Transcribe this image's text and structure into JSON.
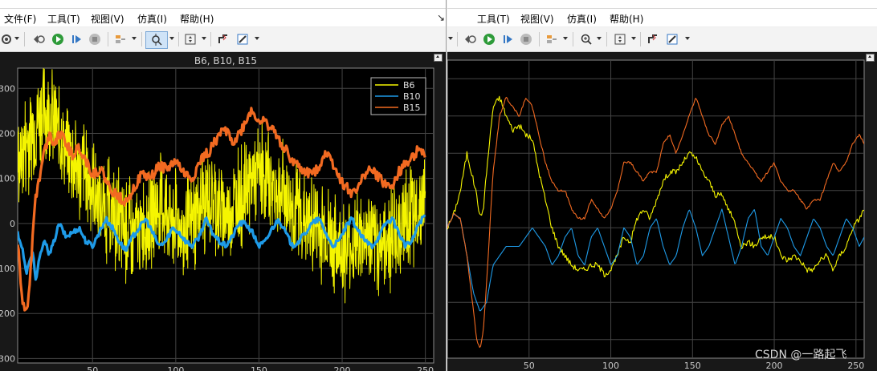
{
  "left_window": {
    "menu": [
      "文件(F)",
      "工具(T)",
      "视图(V)",
      "仿真(I)",
      "帮助(H)"
    ],
    "plot_title": "B6, B10, B15"
  },
  "right_window": {
    "menu": [
      "工具(T)",
      "视图(V)",
      "仿真(I)",
      "帮助(H)"
    ]
  },
  "watermark": "CSDN @一路起飞",
  "colors": {
    "B6": "#f5f500",
    "B10": "#1e9be8",
    "B15": "#f26a21"
  },
  "chart_data": [
    {
      "type": "line",
      "title": "B6, B10, B15",
      "xlabel": "",
      "ylabel": "",
      "xlim": [
        5,
        255
      ],
      "ylim": [
        -310,
        345
      ],
      "xticks": [
        50,
        100,
        150,
        200,
        250
      ],
      "ytick_labels": [
        "300",
        "200",
        "100",
        "0",
        "100",
        "200",
        "300"
      ],
      "ytick_values": [
        300,
        200,
        100,
        0,
        -100,
        -200,
        -300
      ],
      "grid": true,
      "legend": {
        "placement": "top-right",
        "entries": [
          "B6",
          "B10",
          "B15"
        ]
      },
      "series": [
        {
          "name": "B6",
          "style": "noisy",
          "x": [
            5,
            10,
            15,
            20,
            25,
            30,
            35,
            40,
            45,
            50,
            55,
            60,
            65,
            70,
            75,
            80,
            85,
            90,
            95,
            100,
            105,
            110,
            115,
            120,
            125,
            130,
            135,
            140,
            145,
            150,
            155,
            160,
            165,
            170,
            175,
            180,
            185,
            190,
            195,
            200,
            205,
            210,
            215,
            220,
            225,
            230,
            235,
            240,
            245,
            250
          ],
          "values": [
            130,
            180,
            220,
            250,
            240,
            200,
            160,
            130,
            110,
            80,
            40,
            20,
            0,
            -20,
            -30,
            -10,
            20,
            40,
            30,
            0,
            -20,
            0,
            40,
            60,
            40,
            20,
            40,
            70,
            90,
            110,
            100,
            80,
            60,
            40,
            20,
            0,
            -10,
            -20,
            -40,
            -60,
            -50,
            -40,
            -30,
            -50,
            -40,
            -30,
            -10,
            10,
            30,
            50
          ],
          "noise": 110
        },
        {
          "name": "B10",
          "x": [
            5,
            8,
            10,
            12,
            14,
            16,
            18,
            20,
            22,
            24,
            26,
            30,
            34,
            38,
            42,
            46,
            50,
            54,
            58,
            62,
            66,
            70,
            74,
            78,
            82,
            86,
            90,
            94,
            98,
            102,
            106,
            110,
            114,
            118,
            122,
            126,
            130,
            134,
            138,
            142,
            146,
            150,
            154,
            158,
            162,
            166,
            170,
            174,
            178,
            182,
            186,
            190,
            194,
            198,
            202,
            206,
            210,
            214,
            218,
            222,
            226,
            230,
            234,
            238,
            242,
            246,
            250
          ],
          "values": [
            -20,
            -60,
            -110,
            -90,
            -60,
            -130,
            -80,
            -50,
            -40,
            -70,
            -50,
            0,
            -30,
            -20,
            -10,
            -40,
            -50,
            -20,
            10,
            -10,
            -40,
            -60,
            -30,
            -10,
            10,
            -20,
            -50,
            -40,
            -10,
            -20,
            -40,
            -50,
            -30,
            10,
            -20,
            -40,
            -50,
            -30,
            0,
            0,
            -20,
            -50,
            -40,
            -10,
            10,
            -20,
            -50,
            -40,
            -20,
            0,
            10,
            -20,
            -50,
            -40,
            -10,
            10,
            -20,
            -40,
            -50,
            -30,
            0,
            10,
            -20,
            -50,
            -40,
            0,
            20
          ],
          "noise": 6,
          "clip_start": 5
        },
        {
          "name": "B15",
          "x": [
            5,
            7,
            9,
            11,
            13,
            15,
            18,
            21,
            24,
            27,
            30,
            34,
            38,
            42,
            46,
            50,
            55,
            60,
            65,
            70,
            75,
            80,
            85,
            90,
            95,
            100,
            105,
            110,
            115,
            120,
            125,
            130,
            135,
            140,
            145,
            150,
            155,
            160,
            165,
            170,
            175,
            180,
            185,
            190,
            195,
            200,
            205,
            210,
            215,
            220,
            225,
            230,
            235,
            240,
            245,
            250
          ],
          "values": [
            -40,
            -140,
            -200,
            -180,
            -90,
            40,
            100,
            160,
            200,
            180,
            200,
            180,
            150,
            170,
            140,
            110,
            120,
            80,
            60,
            50,
            80,
            110,
            100,
            130,
            120,
            140,
            110,
            100,
            140,
            160,
            190,
            210,
            180,
            210,
            250,
            230,
            220,
            200,
            170,
            140,
            120,
            110,
            120,
            160,
            130,
            90,
            70,
            80,
            120,
            110,
            90,
            80,
            120,
            140,
            160,
            150
          ],
          "noise": 12
        }
      ]
    },
    {
      "type": "line",
      "title": "",
      "xlabel": "",
      "ylabel": "",
      "xlim": [
        0,
        255
      ],
      "ylim": [
        -14,
        18
      ],
      "xticks": [
        50,
        100,
        150,
        200,
        250
      ],
      "xtick_labels": [
        "50",
        "100",
        "150",
        "200",
        "250"
      ],
      "grid": true,
      "series": [
        {
          "color": "#f5f500",
          "x": [
            0,
            4,
            8,
            12,
            16,
            18,
            20,
            22,
            24,
            28,
            32,
            36,
            40,
            44,
            48,
            52,
            56,
            60,
            64,
            68,
            72,
            76,
            80,
            84,
            88,
            92,
            96,
            100,
            104,
            108,
            112,
            116,
            120,
            124,
            128,
            132,
            136,
            140,
            144,
            148,
            152,
            156,
            160,
            164,
            168,
            172,
            176,
            180,
            184,
            188,
            192,
            196,
            200,
            204,
            208,
            212,
            216,
            220,
            224,
            228,
            232,
            236,
            240,
            244,
            248,
            252,
            255
          ],
          "values": [
            0,
            1.5,
            4,
            8,
            5,
            3.5,
            1,
            2,
            6,
            13,
            14,
            12,
            10.5,
            11,
            10,
            9.5,
            6,
            3,
            0,
            -2,
            -3,
            -4,
            -4.5,
            -4.5,
            -4,
            -4,
            -5,
            -4.5,
            -3,
            -1,
            -1.5,
            1,
            2,
            1,
            3,
            5,
            6,
            6,
            7,
            8,
            7.5,
            6,
            5,
            3.5,
            3.5,
            2,
            0.5,
            -2,
            -1.5,
            -2,
            -1,
            -1,
            -1,
            -3,
            -3.5,
            -3,
            -3.5,
            -4.5,
            -4.5,
            -3.5,
            -3,
            -4.5,
            -3,
            -2,
            0,
            1,
            2
          ],
          "noise": 0.3
        },
        {
          "color": "#1e9be8",
          "x": [
            0,
            4,
            8,
            12,
            16,
            20,
            24,
            28,
            32,
            36,
            40,
            44,
            48,
            52,
            56,
            60,
            64,
            68,
            72,
            76,
            80,
            84,
            88,
            92,
            96,
            100,
            104,
            108,
            112,
            116,
            120,
            124,
            128,
            132,
            136,
            140,
            144,
            148,
            152,
            156,
            160,
            164,
            168,
            172,
            176,
            180,
            184,
            188,
            192,
            196,
            200,
            204,
            208,
            212,
            216,
            220,
            224,
            228,
            232,
            236,
            240,
            244,
            248,
            252,
            255
          ],
          "values": [
            0,
            1.5,
            1,
            -3,
            -7,
            -9,
            -8,
            -4,
            -3,
            -2,
            -2,
            -2,
            -1,
            0,
            -1,
            -2,
            -4,
            -3,
            -1,
            0,
            -3,
            -4,
            -1,
            0,
            -2,
            -4,
            -3,
            0,
            -1,
            -4,
            -3,
            0,
            1,
            -2,
            -4,
            -3,
            0,
            2,
            0,
            -3,
            -2,
            0,
            2,
            -1,
            -4,
            -2,
            1,
            2,
            -2,
            -3,
            -1,
            1,
            0,
            -2,
            -3,
            -1,
            1,
            0,
            -2,
            -3,
            -1,
            1,
            0,
            -2,
            -1
          ],
          "noise": 0
        },
        {
          "color": "#f26a21",
          "x": [
            0,
            4,
            8,
            12,
            16,
            18,
            20,
            22,
            24,
            26,
            28,
            32,
            36,
            40,
            44,
            48,
            52,
            56,
            60,
            64,
            68,
            72,
            76,
            80,
            84,
            88,
            92,
            96,
            100,
            104,
            108,
            112,
            116,
            120,
            124,
            128,
            132,
            136,
            140,
            144,
            148,
            152,
            156,
            160,
            164,
            168,
            172,
            176,
            180,
            184,
            188,
            192,
            196,
            200,
            204,
            208,
            212,
            216,
            220,
            224,
            228,
            232,
            236,
            240,
            244,
            248,
            252,
            255
          ],
          "values": [
            0,
            1.5,
            1,
            -3,
            -9,
            -12,
            -13,
            -11,
            -6,
            0,
            6,
            12,
            14,
            13,
            12,
            14,
            13,
            10,
            7,
            5,
            4,
            4,
            2,
            1,
            1,
            3,
            2,
            1,
            2,
            4,
            7,
            7,
            6,
            5,
            6,
            6,
            9,
            10,
            8,
            10,
            12,
            14,
            12,
            10,
            9,
            11,
            12,
            10,
            8,
            7,
            6,
            5,
            6,
            7,
            5,
            4,
            4,
            3,
            2,
            3,
            3,
            5,
            7,
            6,
            7,
            9,
            10,
            9
          ],
          "noise": 0.12
        }
      ]
    }
  ]
}
